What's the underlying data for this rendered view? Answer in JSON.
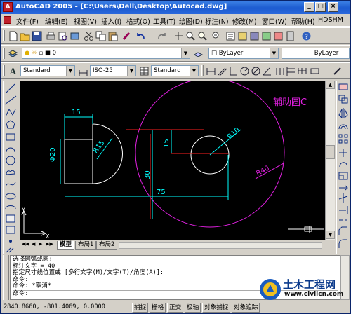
{
  "window": {
    "app_title": "AutoCAD 2005 - [C:\\Users\\Dell\\Desktop\\Autocad.dwg]",
    "min_glyph": "_",
    "max_glyph": "□",
    "close_glyph": "×"
  },
  "menu": {
    "items": [
      "文件(F)",
      "编辑(E)",
      "视图(V)",
      "插入(I)",
      "格式(O)",
      "工具(T)",
      "绘图(D)",
      "标注(N)",
      "修改(M)",
      "窗口(W)",
      "帮助(H)",
      "HDSHM"
    ]
  },
  "layers": {
    "current_layer": "0",
    "color": "ByLayer",
    "linetype": "ByLayer"
  },
  "styles": {
    "text_style": "Standard",
    "dim_style": "ISO-25",
    "table_style": "Standard"
  },
  "drawing": {
    "dim_width": "15",
    "dim_diameter": "Φ20",
    "dim_radius_small": "R15",
    "dim_radius_circle": "R10",
    "dim_vertical_small": "15",
    "dim_vertical": "30",
    "dim_horizontal": "75",
    "dim_radius_large": "R40",
    "annotation": "辅助圆C",
    "ucs_y": "Y",
    "ucs_x": "X",
    "color_cyan": "#00ffff",
    "color_white": "#ffffff",
    "color_red": "#ff2020",
    "color_magenta": "#e020e0"
  },
  "tabs": [
    "模型",
    "布局1",
    "布局2"
  ],
  "command": {
    "lines": [
      "选择圆弧或圆:",
      "标注文字 = 40",
      "指定尺寸线位置或 [多行文字(M)/文字(T)/角度(A)]:",
      "命令:",
      "命令: *取消*",
      "命令:"
    ]
  },
  "status": {
    "coords": "2840.8660, -801.4069, 0.0000",
    "buttons": [
      "捕捉",
      "栅格",
      "正交",
      "极轴",
      "对象捕捉",
      "对象追踪"
    ]
  },
  "watermark": {
    "title": "土木工程网",
    "url": "www.civilcn.com"
  }
}
